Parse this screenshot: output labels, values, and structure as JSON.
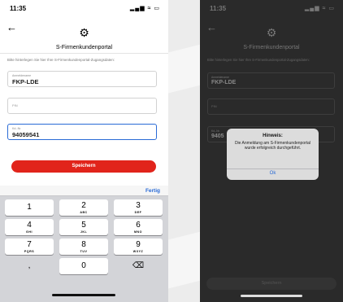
{
  "left": {
    "status_time": "11:35",
    "status_icons": "▂▄▆ ≈ ▭",
    "back_glyph": "←",
    "gear_glyph": "⚙",
    "title": "S-Firmenkundenportal",
    "instruction": "Bitte hinterlegen Sie hier Ihre S-Firmenkundenportal-Zugangsdaten:",
    "fields": [
      {
        "label": "Anmeldename",
        "value": "FKP-LDE",
        "placeholder": ""
      },
      {
        "label": "",
        "value": "",
        "placeholder": "PIN"
      },
      {
        "label": "Kd.-Nr.",
        "value": "94059541",
        "placeholder": ""
      }
    ],
    "save_label": "Speichern",
    "done_label": "Fertig",
    "keys": [
      {
        "d": "1",
        "l": ""
      },
      {
        "d": "2",
        "l": "ABC"
      },
      {
        "d": "3",
        "l": "DEF"
      },
      {
        "d": "4",
        "l": "GHI"
      },
      {
        "d": "5",
        "l": "JKL"
      },
      {
        "d": "6",
        "l": "MNO"
      },
      {
        "d": "7",
        "l": "PQRS"
      },
      {
        "d": "8",
        "l": "TUV"
      },
      {
        "d": "9",
        "l": "WXYZ"
      },
      {
        "d": ",",
        "l": ""
      },
      {
        "d": "0",
        "l": ""
      },
      {
        "d": "⌫",
        "l": ""
      }
    ]
  },
  "right": {
    "status_time": "11:35",
    "status_icons": "▂▄▆ ≈ ▭",
    "back_glyph": "←",
    "gear_glyph": "⚙",
    "title": "S-Firmenkundenportal",
    "instruction": "Bitte hinterlegen Sie hier Ihre S-Firmenkundenportal-Zugangsdaten:",
    "fields": [
      {
        "label": "Anmeldename",
        "value": "FKP-LDE",
        "placeholder": ""
      },
      {
        "label": "",
        "value": "",
        "placeholder": "PIN"
      },
      {
        "label": "Kd.-Nr.",
        "value": "9405",
        "placeholder": ""
      }
    ],
    "dialog": {
      "title": "Hinweis:",
      "message": "Die Anmeldung am S-Firmenkundenportal wurde erfolgreich durchgeführt.",
      "ok_label": "Ok"
    },
    "save_label": "Speichern"
  }
}
